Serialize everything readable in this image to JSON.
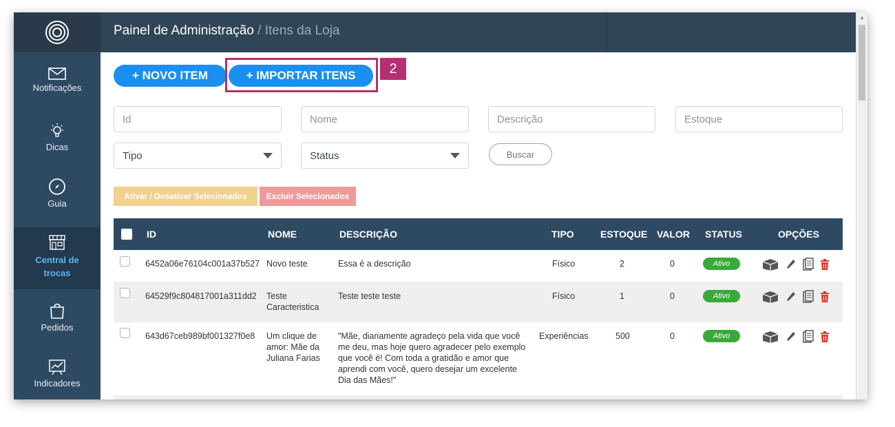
{
  "header": {
    "title": "Painel de Administração",
    "breadcrumb_sep": " / ",
    "subtitle": "Itens da Loja"
  },
  "sidebar": {
    "items": [
      {
        "label": "Notificações",
        "icon": "mail-icon"
      },
      {
        "label": "Dicas",
        "icon": "lightbulb-icon"
      },
      {
        "label": "Guia",
        "icon": "compass-icon"
      },
      {
        "label": "Central de trocas",
        "icon": "store-icon",
        "active": true
      },
      {
        "label": "Pedidos",
        "icon": "shopping-bag-icon"
      },
      {
        "label": "Indicadores",
        "icon": "chart-board-icon"
      }
    ]
  },
  "actions": {
    "new_item": "+ NOVO ITEM",
    "import_items": "+ IMPORTAR ITENS",
    "callout_number": "2"
  },
  "filters": {
    "id_placeholder": "Id",
    "name_placeholder": "Nome",
    "description_placeholder": "Descrição",
    "stock_placeholder": "Estoque",
    "type_select": "Tipo",
    "status_select": "Status",
    "search_button": "Buscar"
  },
  "bulk": {
    "toggle_label": "Ativar / Desativar Selecionados",
    "delete_label": "Excluir Selecionados"
  },
  "table": {
    "headers": {
      "id": "ID",
      "name": "NOME",
      "description": "DESCRIÇÃO",
      "type": "TIPO",
      "stock": "ESTOQUE",
      "value": "VALOR",
      "status": "STATUS",
      "options": "OPÇÕES"
    },
    "rows": [
      {
        "id": "6452a06e76104c001a37b527",
        "name": "Novo teste",
        "description": "Essa é a descrição",
        "type": "Físico",
        "stock": "2",
        "value": "0",
        "status": "Ativo"
      },
      {
        "id": "64529f9c804817001a311dd2",
        "name": "Teste Caracteristica",
        "description": "Teste teste teste",
        "type": "Físico",
        "stock": "1",
        "value": "0",
        "status": "Ativo"
      },
      {
        "id": "643d67ceb989bf001327f0e8",
        "name": "Um clique de amor: Mãe da Juliana Farias",
        "description": "\"Mãe, diariamente agradeço pela vida que você me deu, mas hoje quero agradecer pelo exemplo que você é! Com toda a gratidão e amor que aprendi com você, quero desejar um excelente Dia das Mães!\"",
        "type": "Experiências",
        "stock": "500",
        "value": "0",
        "status": "Ativo"
      }
    ]
  },
  "colors": {
    "primary": "#1a8ff0",
    "sidebar": "#2e4a62",
    "callout": "#b5306f",
    "active_status": "#3aa93a",
    "delete": "#e0342c"
  }
}
